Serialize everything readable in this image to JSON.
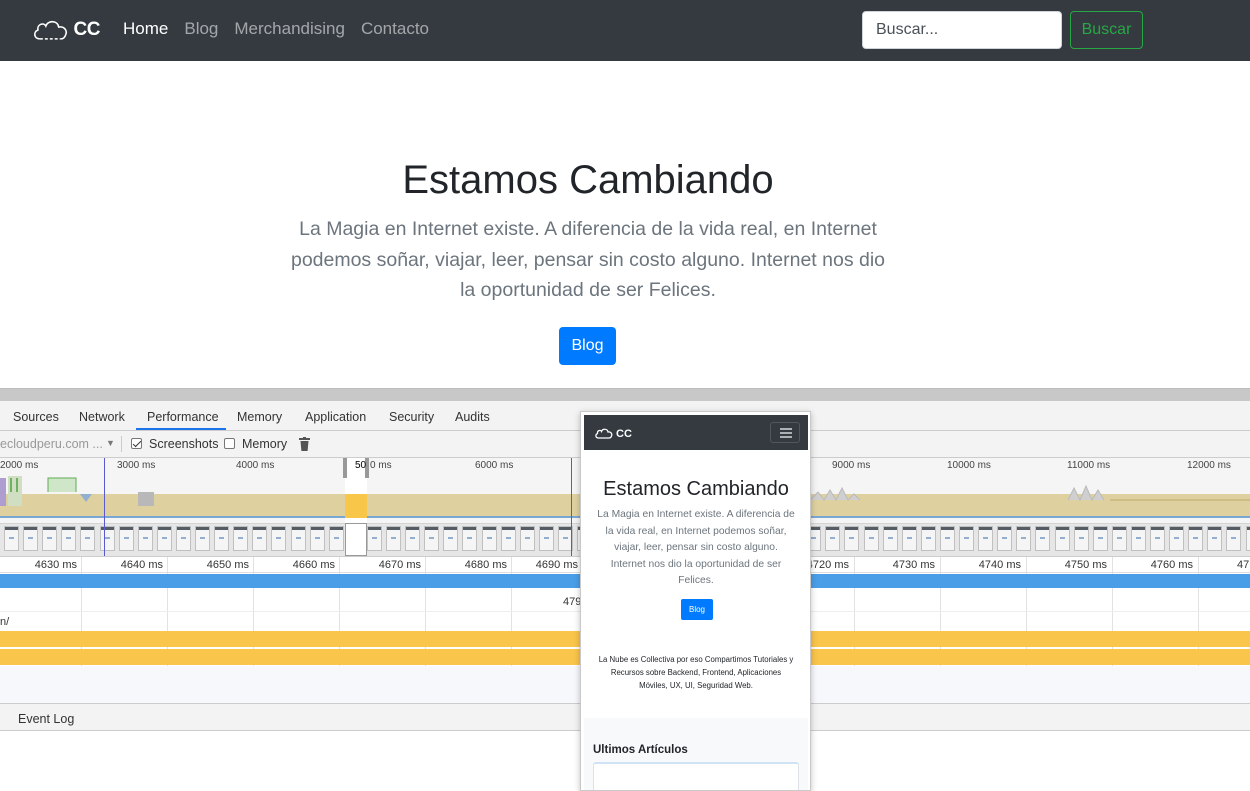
{
  "navbar": {
    "brand": "CC",
    "links": [
      "Home",
      "Blog",
      "Merchandising",
      "Contacto"
    ],
    "active_link": "Home",
    "search_placeholder": "Buscar...",
    "search_button": "Buscar"
  },
  "hero": {
    "title": "Estamos Cambiando",
    "lead": "La Magia en Internet existe. A diferencia de la vida real, en Internet podemos soñar, viajar, leer, pensar sin costo alguno. Internet nos dio la oportunidad de ser Felices.",
    "button": "Blog"
  },
  "devtools": {
    "tabs": [
      "Sources",
      "Network",
      "Performance",
      "Memory",
      "Application",
      "Security",
      "Audits"
    ],
    "active_tab": "Performance",
    "toolbar": {
      "url": "ecloudperu.com ...",
      "screenshots_label": "Screenshots",
      "screenshots_checked": true,
      "memory_label": "Memory",
      "memory_checked": false
    },
    "overview_ticks": [
      "2000 ms",
      "3000 ms",
      "4000 ms",
      "50",
      "0 ms",
      "6000 ms",
      "9000 ms",
      "10000 ms",
      "11000 ms",
      "12000 ms"
    ],
    "flame_ticks": [
      "4630 ms",
      "4640 ms",
      "4650 ms",
      "4660 ms",
      "4670 ms",
      "4680 ms",
      "4690 ms",
      "4720 ms",
      "4730 ms",
      "4740 ms",
      "4750 ms",
      "4760 ms",
      "47"
    ],
    "flame_number": "479",
    "flame_label": "n/",
    "drawer_tab": "Event Log"
  },
  "popover": {
    "brand": "CC",
    "title": "Estamos Cambiando",
    "lead": "La Magia en Internet existe. A diferencia de la vida real, en Internet podemos soñar, viajar, leer, pensar sin costo alguno. Internet nos dio la oportunidad de ser Felices.",
    "button": "Blog",
    "description": "La Nube es Collectiva por eso Compartimos Tutoriales y Recursos sobre Backend, Frontend, Aplicaciones Móviles, UX, UI, Seguridad Web.",
    "section_title": "Ultimos Artículos"
  },
  "colors": {
    "navbar_bg": "#343a40",
    "primary": "#007bff",
    "success": "#28a745",
    "flame_blue": "#4a9ee8",
    "flame_yellow": "#fac54b"
  }
}
